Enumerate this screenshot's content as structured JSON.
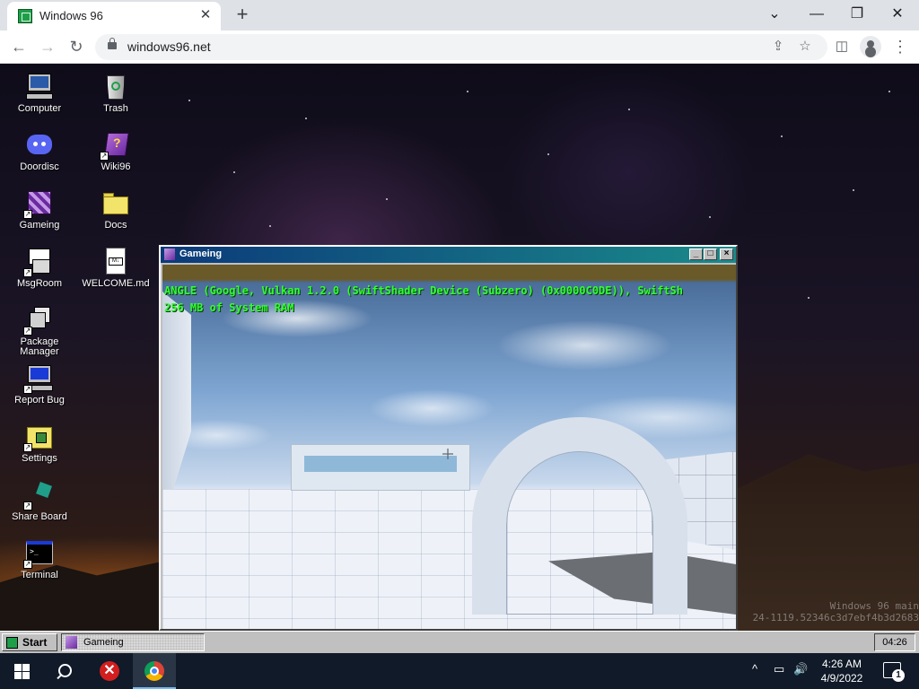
{
  "browser": {
    "tab_title": "Windows 96",
    "tab_close": "✕",
    "new_tab": "+",
    "url": "windows96.net",
    "window_controls": {
      "minimize": "⌄",
      "restore": "—",
      "maximize": "❐",
      "close": "✕"
    }
  },
  "desktop": {
    "icons": [
      {
        "label": "Computer",
        "icon": "computer-icon"
      },
      {
        "label": "Trash",
        "icon": "trash-icon"
      },
      {
        "label": "Doordisc",
        "icon": "doordisc-icon"
      },
      {
        "label": "Wiki96",
        "icon": "wiki-book-icon"
      },
      {
        "label": "Gameing",
        "icon": "game-cube-icon"
      },
      {
        "label": "Docs",
        "icon": "folder-icon"
      },
      {
        "label": "MsgRoom",
        "icon": "msgroom-icon"
      },
      {
        "label": "WELCOME.md",
        "icon": "markdown-file-icon"
      },
      {
        "label": "Package Manager",
        "icon": "package-manager-icon"
      },
      {
        "label": "Report Bug",
        "icon": "report-bug-icon"
      },
      {
        "label": "Settings",
        "icon": "settings-icon"
      },
      {
        "label": "Share Board",
        "icon": "share-board-icon"
      },
      {
        "label": "Terminal",
        "icon": "terminal-icon"
      }
    ],
    "watermark_line1": "Windows 96 main",
    "watermark_line2": "24-1119.52346c3d7ebf4b3d2683"
  },
  "game_window": {
    "title": "Gameing",
    "hud_line1": "ANGLE (Google, Vulkan 1.2.0 (SwiftShader Device (Subzero) (0x0000C0DE)), SwiftSh",
    "hud_line2": "256 MB of System RAM",
    "hud_color": "#31ff31"
  },
  "w96_taskbar": {
    "start_label": "Start",
    "task_label": "Gameing",
    "clock": "04:26"
  },
  "windows_taskbar": {
    "time": "4:26 AM",
    "date": "4/9/2022",
    "notification_count": "1",
    "tray_chevron": "^",
    "volume_glyph": "🔊",
    "network_glyph": "▭"
  }
}
